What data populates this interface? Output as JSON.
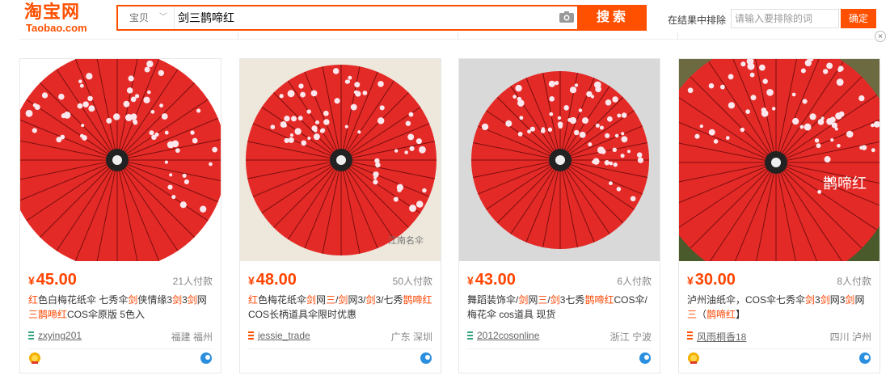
{
  "header": {
    "logo_cn": "淘宝网",
    "logo_en": "Taobao.com",
    "scope_label": "宝贝",
    "query": "剑三鹊啼红",
    "search_label": "搜索",
    "exclude_label": "在结果中排除",
    "exclude_placeholder": "请输入要排除的词",
    "exclude_button": "确定",
    "close_glyph": "×"
  },
  "colors": {
    "accent": "#ff5000",
    "price": "#ff4400",
    "umbrella": "#e42a26"
  },
  "products": [
    {
      "price_symbol": "¥",
      "price": "45.00",
      "paid": "21人付款",
      "title_html": "<em>红</em>色白梅花纸伞 七秀伞<em>剑</em>侠情缘3<em>剑</em>3<em>剑</em>网<em>三鹊啼红</em>COS伞原版 5色入",
      "title_text": "红色白梅花纸伞 七秀伞剑侠情缘3剑3剑网三鹊啼红COS伞原版 5色入",
      "shop": "zxying201",
      "location": "福建 福州",
      "shop_icon_color": "#33a57a",
      "medal": "gold-medal-icon",
      "wangwang": "wangwang-icon"
    },
    {
      "price_symbol": "¥",
      "price": "48.00",
      "paid": "50人付款",
      "title_html": "<em>红</em>色梅花纸伞<em>剑</em>网<em>三</em>/<em>剑</em>网3/<em>剑</em>3/七秀<em>鹊啼红</em>COS长柄道具伞限时优惠",
      "title_text": "红色梅花纸伞剑网三/剑网3/剑3/七秀鹊啼红COS长柄道具伞限时优惠",
      "shop": "jessie_trade",
      "location": "广东 深圳",
      "shop_icon_color": "#ff5000",
      "medal": "",
      "wangwang": "wangwang-icon"
    },
    {
      "price_symbol": "¥",
      "price": "43.00",
      "paid": "6人付款",
      "title_html": "舞蹈装饰伞/<em>剑</em>网<em>三</em>/<em>剑</em>3七秀<em>鹊啼红</em>COS伞/梅花伞 cos道具 现货",
      "title_text": "舞蹈装饰伞/剑网三/剑3七秀鹊啼红COS伞/梅花伞 cos道具 现货",
      "shop": "2012cosonline",
      "location": "浙江 宁波",
      "shop_icon_color": "#33a57a",
      "medal": "",
      "wangwang": "wangwang-icon"
    },
    {
      "price_symbol": "¥",
      "price": "30.00",
      "paid": "8人付款",
      "title_html": "泸州油纸伞，COS伞七秀伞<em>剑</em>3<em>剑</em>网3<em>剑</em>网<em>三</em>（<em>鹊啼红</em>】",
      "title_text": "泸州油纸伞，COS伞七秀伞剑3剑网3剑网三（鹊啼红】",
      "shop": "风雨桐香18",
      "location": "四川 泸州",
      "shop_icon_color": "#ff5000",
      "medal": "gold-medal-icon",
      "wangwang": "wangwang-icon"
    }
  ],
  "image_captions": [
    "",
    "江南名伞",
    "",
    "鹊啼红"
  ]
}
